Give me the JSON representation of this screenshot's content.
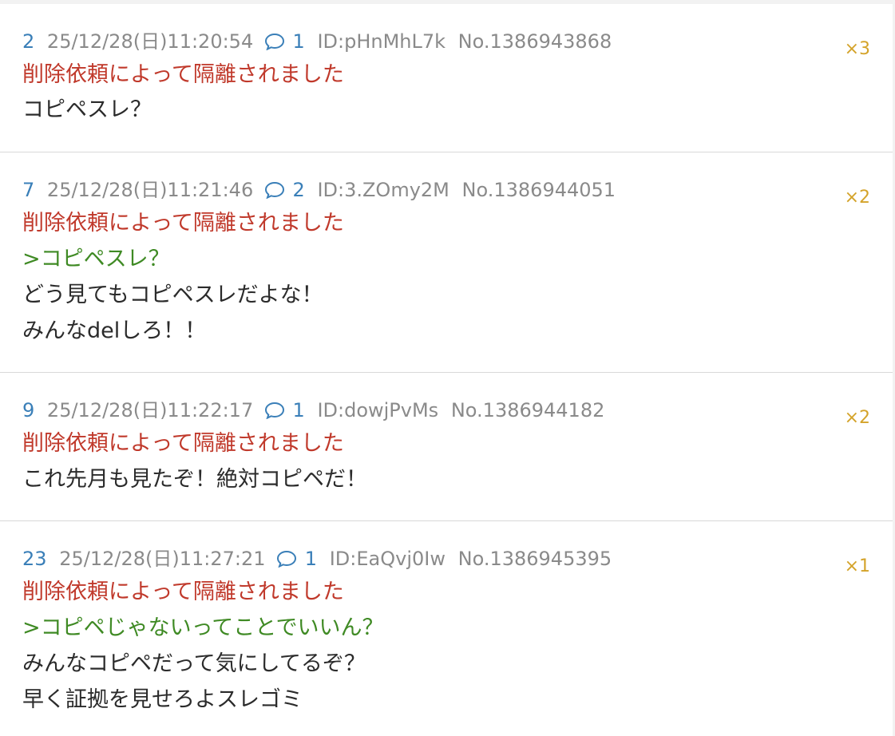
{
  "posts": [
    {
      "number": "2",
      "date": "25/12/28(日)11:20:54",
      "replies": "1",
      "id": "ID:pHnMhL7k",
      "no": "No.1386943868",
      "count": "×3",
      "deleted_notice": "削除依頼によって隔離されました",
      "lines": [
        "コピペスレ？"
      ]
    },
    {
      "number": "7",
      "date": "25/12/28(日)11:21:46",
      "replies": "2",
      "id": "ID:3.ZOmy2M",
      "no": "No.1386944051",
      "count": "×2",
      "deleted_notice": "削除依頼によって隔離されました",
      "quote": ">コピペスレ？",
      "lines": [
        "どう見てもコピペスレだよな！",
        "みんなdelしろ！！"
      ]
    },
    {
      "number": "9",
      "date": "25/12/28(日)11:22:17",
      "replies": "1",
      "id": "ID:dowjPvMs",
      "no": "No.1386944182",
      "count": "×2",
      "deleted_notice": "削除依頼によって隔離されました",
      "lines": [
        "これ先月も見たぞ！絶対コピペだ！"
      ]
    },
    {
      "number": "23",
      "date": "25/12/28(日)11:27:21",
      "replies": "1",
      "id": "ID:EaQvj0Iw",
      "no": "No.1386945395",
      "count": "×1",
      "deleted_notice": "削除依頼によって隔離されました",
      "quote": ">コピペじゃないってことでいいん？",
      "lines": [
        "みんなコピペだって気にしてるぞ？",
        "早く証拠を見せろよスレゴミ"
      ]
    }
  ],
  "icons": {
    "reply": "speech-bubble-icon"
  },
  "colors": {
    "post_number": "#3a7fb8",
    "deleted_notice": "#c0392b",
    "quote": "#3f8a24",
    "count_badge": "#d4a32a",
    "meta": "#8a8a8a"
  }
}
